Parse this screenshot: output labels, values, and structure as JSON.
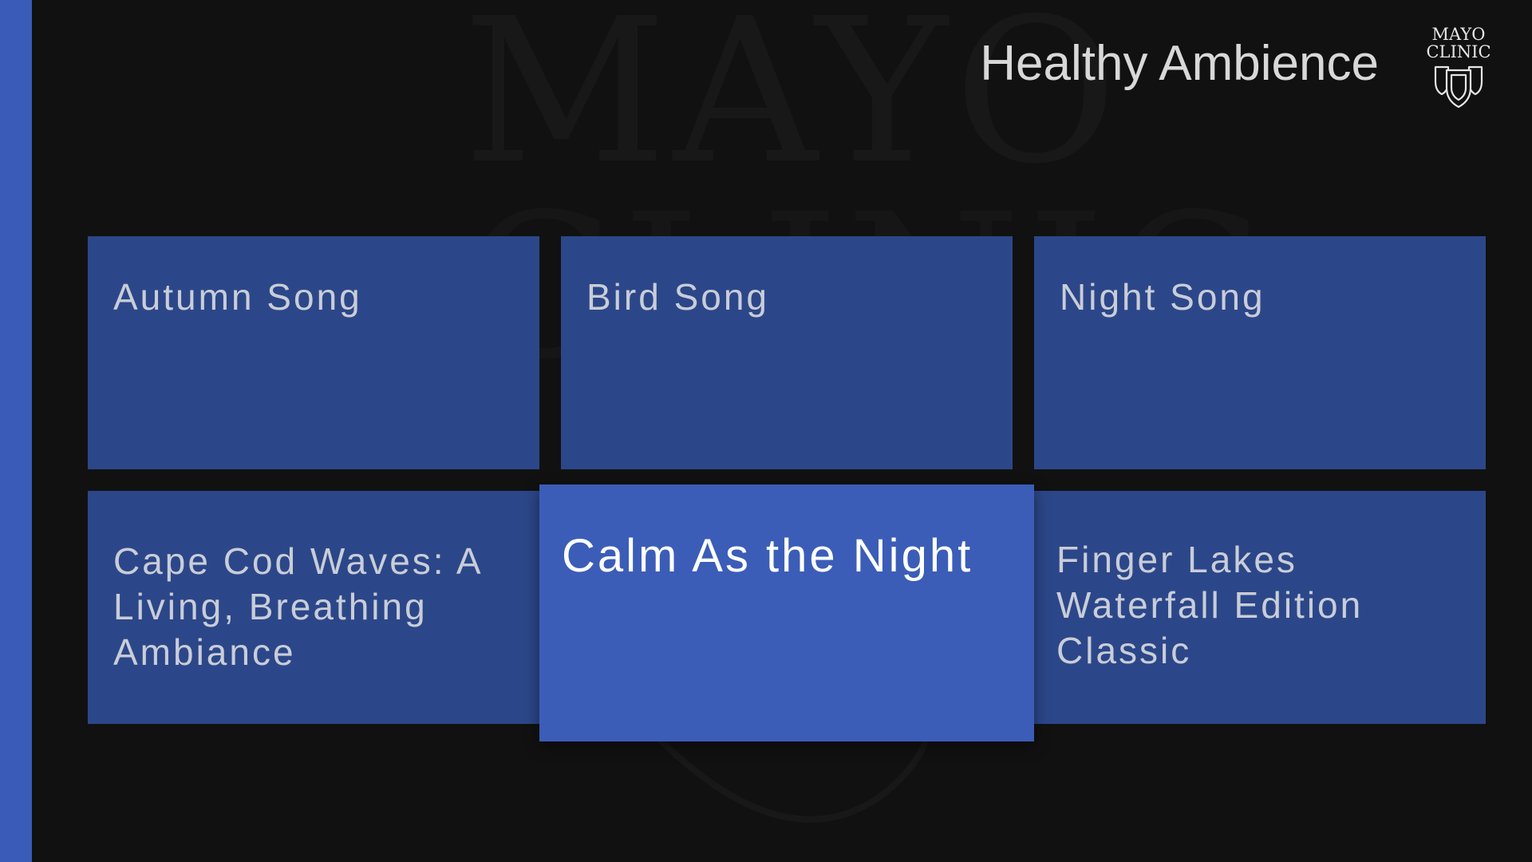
{
  "app": {
    "title": "Healthy Ambience",
    "logo_text": [
      "MAYO",
      "CLINIC"
    ],
    "watermark_text": [
      "MAYO",
      "CLINIC"
    ]
  },
  "colors": {
    "background": "#111111",
    "nav_strip": "#3a5bb8",
    "tile": "#2c4789",
    "tile_focused": "#3b5db8",
    "tile_text": "#c9cdd8",
    "tile_text_focused": "#ffffff"
  },
  "tiles": [
    {
      "label": "Autumn Song",
      "focused": false
    },
    {
      "label": "Bird Song",
      "focused": false
    },
    {
      "label": "Night Song",
      "focused": false
    },
    {
      "label": "Cape Cod Waves: A Living, Breathing Ambiance",
      "focused": false
    },
    {
      "label": "Calm As the Night",
      "focused": true
    },
    {
      "label": "Finger Lakes Waterfall Edition Classic",
      "focused": false
    }
  ],
  "icons": {
    "logo": "mayo-clinic-shields-icon"
  }
}
